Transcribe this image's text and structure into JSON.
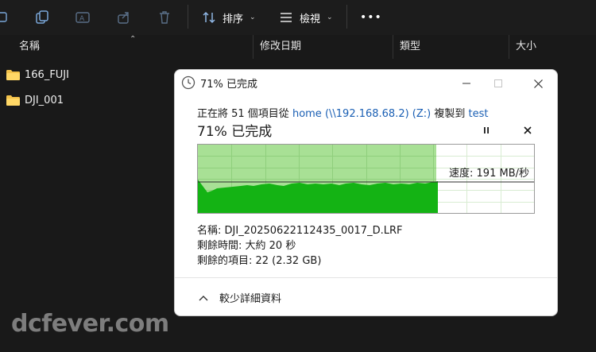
{
  "toolbar": {
    "sort_label": "排序",
    "view_label": "檢視",
    "more_label": "•••"
  },
  "columns": {
    "name": "名稱",
    "modified": "修改日期",
    "type": "類型",
    "size": "大小"
  },
  "files": [
    {
      "name": "166_FUJI"
    },
    {
      "name": "DJI_001"
    }
  ],
  "dialog": {
    "title": "71% 已完成",
    "copy_prefix": "正在將 51 個項目從",
    "source": "home (\\\\192.168.68.2) (Z:)",
    "copy_middle": "複製到",
    "destination": "test",
    "progress_text": "71% 已完成",
    "progress_fraction": 0.71,
    "speed": "速度: 191 MB/秒",
    "name_line": "名稱: DJI_20250622112435_0017_D.LRF",
    "time_remaining": "剩餘時間: 大約 20 秒",
    "items_remaining": "剩餘的項目: 22 (2.32 GB)",
    "less_details": "較少詳細資料",
    "colors": {
      "fill_light": "#a8e095",
      "fill_dark": "#14b314",
      "link": "#1a5fb4"
    }
  },
  "watermark": "dcfever.com"
}
